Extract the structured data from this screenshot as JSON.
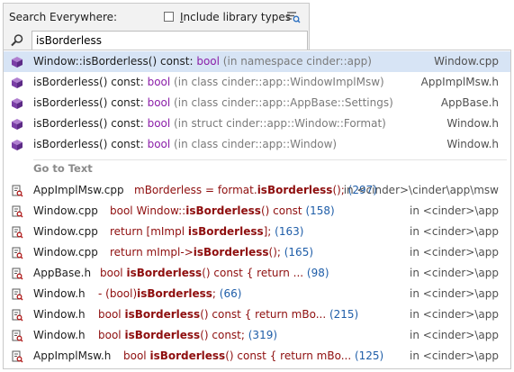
{
  "header": {
    "title": "Search Everywhere:",
    "include_library_prefix": "I",
    "include_library_rest": "nclude library types",
    "include_library_checked": false
  },
  "search": {
    "value": "isBorderless"
  },
  "symbols": [
    {
      "pre": "Window::",
      "name": "isBorderless",
      "post": "() const: ",
      "type": "bool",
      "context": " (in namespace cinder::app)",
      "file": "Window.cpp",
      "selected": true
    },
    {
      "pre": "",
      "name": "isBorderless",
      "post": "() const: ",
      "type": "bool",
      "context": " (in class cinder::app::WindowImplMsw)",
      "file": "AppImplMsw.h",
      "selected": false
    },
    {
      "pre": "",
      "name": "isBorderless",
      "post": "() const: ",
      "type": "bool",
      "context": " (in class cinder::app::AppBase::Settings)",
      "file": "AppBase.h",
      "selected": false
    },
    {
      "pre": "",
      "name": "isBorderless",
      "post": "() const: ",
      "type": "bool",
      "context": " (in struct cinder::app::Window::Format)",
      "file": "Window.h",
      "selected": false
    },
    {
      "pre": "",
      "name": "isBorderless",
      "post": "() const: ",
      "type": "bool",
      "context": " (in class cinder::app::Window)",
      "file": "Window.h",
      "selected": false
    }
  ],
  "goto_text_header": "Go to Text",
  "text_results": [
    {
      "file": "AppImplMsw.cpp",
      "before": "mBorderless = format.",
      "match": "isBorderless",
      "after": "();",
      "line": " (297)",
      "path": "in <cinder>\\cinder\\app\\msw"
    },
    {
      "file": "Window.cpp",
      "before": "bool Window::",
      "match": "isBorderless",
      "after": "() const",
      "line": " (158)",
      "path": "in <cinder>\\app"
    },
    {
      "file": "Window.cpp",
      "before": "return [mImpl ",
      "match": "isBorderless",
      "after": "];",
      "line": " (163)",
      "path": "in <cinder>\\app"
    },
    {
      "file": "Window.cpp",
      "before": "return mImpl->",
      "match": "isBorderless",
      "after": "();",
      "line": " (165)",
      "path": "in <cinder>\\app"
    },
    {
      "file": "AppBase.h",
      "before": "bool ",
      "match": "isBorderless",
      "after": "() const        { return ...",
      "line": " (98)",
      "path": "in <cinder>\\app"
    },
    {
      "file": "Window.h",
      "before": "- (bool)",
      "match": "isBorderless",
      "after": ";",
      "line": " (66)",
      "path": "in <cinder>\\app"
    },
    {
      "file": "Window.h",
      "before": "bool  ",
      "match": "isBorderless",
      "after": "() const { return mBo...",
      "line": " (215)",
      "path": "in <cinder>\\app"
    },
    {
      "file": "Window.h",
      "before": "bool ",
      "match": "isBorderless",
      "after": "() const;",
      "line": " (319)",
      "path": "in <cinder>\\app"
    },
    {
      "file": "AppImplMsw.h",
      "before": "bool  ",
      "match": "isBorderless",
      "after": "() const { return mBo...",
      "line": " (125)",
      "path": "in <cinder>\\app"
    }
  ],
  "colors": {
    "keyword": "#8b1fa8",
    "code": "#8e0e0e",
    "line_number": "#1e5da8",
    "selection": "#d7e4f5"
  },
  "icons": {
    "symbol": "method-cube-icon",
    "text": "text-file-search-icon"
  }
}
